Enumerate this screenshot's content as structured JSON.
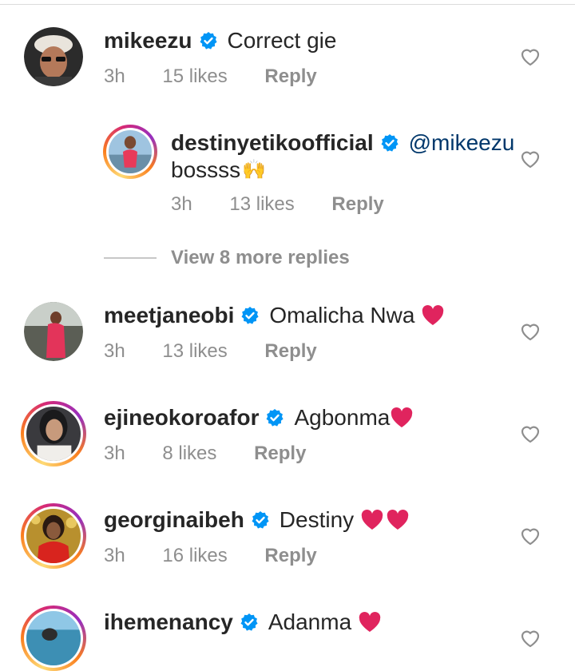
{
  "comments": [
    {
      "username": "mikeezu",
      "text": "Correct gie",
      "time": "3h",
      "likes": "15 likes",
      "reply": "Reply",
      "heart": "heart-outline-icon"
    },
    {
      "username": "destinyetikoofficial",
      "mention": "@mikeezu",
      "text": "bossss",
      "emoji": "🙌",
      "time": "3h",
      "likes": "13 likes",
      "reply": "Reply"
    },
    {
      "username": "meetjaneobi",
      "text": "Omalicha Nwa",
      "time": "3h",
      "likes": "13 likes",
      "reply": "Reply"
    },
    {
      "username": "ejineokoroafor",
      "text": "Agbonma",
      "time": "3h",
      "likes": "8 likes",
      "reply": "Reply"
    },
    {
      "username": "georginaibeh",
      "text": "Destiny",
      "time": "3h",
      "likes": "16 likes",
      "reply": "Reply"
    },
    {
      "username": "ihemenancy",
      "text": "Adanma"
    }
  ],
  "view_more": "View 8 more replies",
  "colors": {
    "verified": "#0095f6",
    "heart_emoji": "#e0245e",
    "meta": "#8e8e8e",
    "mention": "#00376b"
  }
}
